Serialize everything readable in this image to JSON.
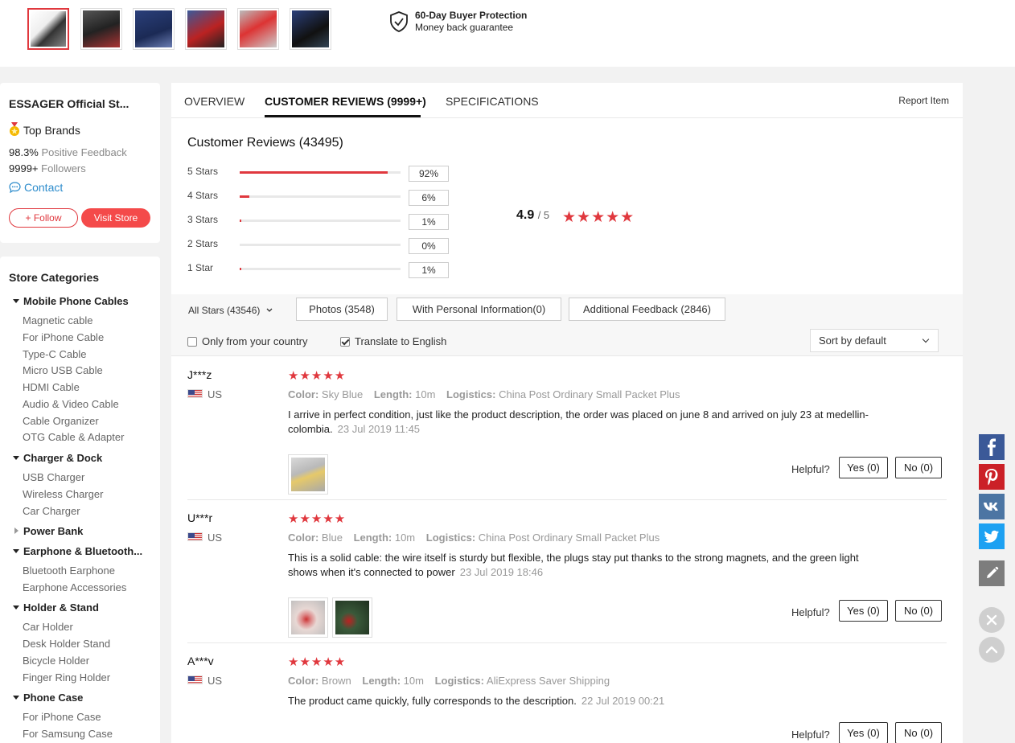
{
  "protection": {
    "title": "60-Day Buyer Protection",
    "subtitle": "Money back guarantee"
  },
  "thumbnails": [
    "thumb-1",
    "thumb-2",
    "thumb-3",
    "thumb-4",
    "thumb-5",
    "thumb-6"
  ],
  "store": {
    "name": "ESSAGER Official St...",
    "badge": "Top Brands",
    "feedback_value": "98.3%",
    "feedback_label": "Positive Feedback",
    "followers_value": "9999+",
    "followers_label": "Followers",
    "contact": "Contact",
    "follow_label": "+ Follow",
    "visit_label": "Visit Store"
  },
  "categories": {
    "title": "Store Categories",
    "groups": [
      {
        "label": "Mobile Phone Cables",
        "expanded": true,
        "items": [
          "Magnetic cable",
          "For iPhone Cable",
          "Type-C Cable",
          "Micro USB Cable",
          "HDMI Cable",
          "Audio & Video Cable",
          "Cable Organizer",
          "OTG Cable & Adapter"
        ]
      },
      {
        "label": "Charger & Dock",
        "expanded": true,
        "items": [
          "USB Charger",
          "Wireless Charger",
          "Car Charger"
        ]
      },
      {
        "label": "Power Bank",
        "expanded": false,
        "items": []
      },
      {
        "label": "Earphone & Bluetooth...",
        "expanded": true,
        "items": [
          "Bluetooth Earphone",
          "Earphone Accessories"
        ]
      },
      {
        "label": "Holder & Stand",
        "expanded": true,
        "items": [
          "Car Holder",
          "Desk Holder Stand",
          "Bicycle Holder",
          "Finger Ring Holder"
        ]
      },
      {
        "label": "Phone Case",
        "expanded": true,
        "items": [
          "For iPhone Case",
          "For Samsung Case"
        ]
      }
    ]
  },
  "tabs": {
    "overview": "OVERVIEW",
    "reviews": "CUSTOMER REVIEWS (9999+)",
    "specs": "SPECIFICATIONS",
    "active": "reviews",
    "report": "Report Item"
  },
  "reviews_summary": {
    "title": "Customer Reviews (43495)",
    "rows": [
      {
        "label": "5 Stars",
        "percent": "92%",
        "fraction": 0.92
      },
      {
        "label": "4 Stars",
        "percent": "6%",
        "fraction": 0.06
      },
      {
        "label": "3 Stars",
        "percent": "1%",
        "fraction": 0.01
      },
      {
        "label": "2 Stars",
        "percent": "0%",
        "fraction": 0.0
      },
      {
        "label": "1 Star",
        "percent": "1%",
        "fraction": 0.01
      }
    ],
    "average": "4.9",
    "out_of": "/ 5",
    "stars": "★★★★★"
  },
  "filters": {
    "all_stars": "All Stars (43546)",
    "photos": "Photos (3548)",
    "with_info": "With Personal Information(0)",
    "additional": "Additional Feedback (2846)",
    "only_country": "Only from your country",
    "only_country_checked": false,
    "translate": "Translate to English",
    "translate_checked": true,
    "sort": "Sort by default"
  },
  "reviews": [
    {
      "name": "J***z",
      "country": "US",
      "stars": "★★★★★",
      "color_label": "Color:",
      "color": "Sky Blue",
      "length_label": "Length:",
      "length": "10m",
      "logistics_label": "Logistics:",
      "logistics": "China Post Ordinary Small Packet Plus",
      "text": "I arrive in perfect condition, just like the product description, the order was placed on june 8 and arrived on july 23 at medellin-colombia.",
      "date": "23 Jul 2019 11:45",
      "photos": 1,
      "helpful": "Helpful?",
      "yes": "Yes (0)",
      "no": "No (0)"
    },
    {
      "name": "U***r",
      "country": "US",
      "stars": "★★★★★",
      "color_label": "Color:",
      "color": "Blue",
      "length_label": "Length:",
      "length": "10m",
      "logistics_label": "Logistics:",
      "logistics": "China Post Ordinary Small Packet Plus",
      "text": "This is a solid cable: the wire itself is sturdy but flexible, the plugs stay put thanks to the strong magnets, and the green light shows when it's connected to power",
      "date": "23 Jul 2019 18:46",
      "photos": 2,
      "helpful": "Helpful?",
      "yes": "Yes (0)",
      "no": "No (0)"
    },
    {
      "name": "A***v",
      "country": "US",
      "stars": "★★★★★",
      "color_label": "Color:",
      "color": "Brown",
      "length_label": "Length:",
      "length": "10m",
      "logistics_label": "Logistics:",
      "logistics": "AliExpress Saver Shipping",
      "text": "The product came quickly, fully corresponds to the description.",
      "date": "22 Jul 2019 00:21",
      "photos": 0,
      "helpful": "Helpful?",
      "yes": "Yes (0)",
      "no": "No (0)"
    }
  ],
  "share": [
    "facebook-icon",
    "pinterest-icon",
    "vk-icon",
    "twitter-icon",
    "edit-icon"
  ],
  "colors": {
    "accent": "#e0383e",
    "link": "#2d8ccc",
    "facebook": "#3b5998",
    "pinterest": "#cb2027",
    "vk": "#4c75a3",
    "twitter": "#1da1f2"
  }
}
